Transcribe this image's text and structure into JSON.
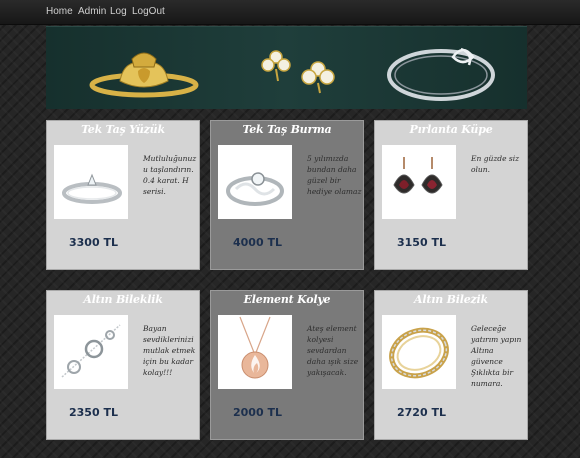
{
  "nav": {
    "items": [
      "Home",
      "Admin",
      "Log",
      "LogOut"
    ]
  },
  "banner": {
    "icons": [
      "claddagh-ring-icon",
      "clover-earrings-icon",
      "silver-bangle-icon"
    ]
  },
  "products": [
    {
      "title": "Tek Taş Yüzük",
      "description": "Mutluluğunuzu taşlandırın. 0.4 karat. H serisi.",
      "price": "3300 TL",
      "image": "solitaire-ring-icon"
    },
    {
      "title": "Tek Taş Burma",
      "description": "5 yılımızda bundan daha güzel bir hediye olamaz",
      "price": "4000 TL",
      "image": "twist-ring-icon"
    },
    {
      "title": "Pırlanta Küpe",
      "description": "En güzde siz olun.",
      "price": "3150 TL",
      "image": "ruby-earrings-icon"
    },
    {
      "title": "Altın Bileklik",
      "description": "Bayan sevdiklerinizi mutlak etmek için bu kadar kolay!!!",
      "price": "2350 TL",
      "image": "silver-bracelet-icon"
    },
    {
      "title": "Element Kolye",
      "description": "Ateş element kolyesi sevdardan daha ışık size yakışacak.",
      "price": "2000 TL",
      "image": "fire-pendant-icon"
    },
    {
      "title": "Altın Bilezik",
      "description": "Geleceğe yatırım yapın Altına güvence Şıklıkta bir numara.",
      "price": "2720 TL",
      "image": "gold-bangle-icon"
    }
  ],
  "colors": {
    "price": "#1c2f4d",
    "banner": "#1f3e3b",
    "card_light": "#d4d4d4",
    "card_dark": "#7a7a7a"
  }
}
